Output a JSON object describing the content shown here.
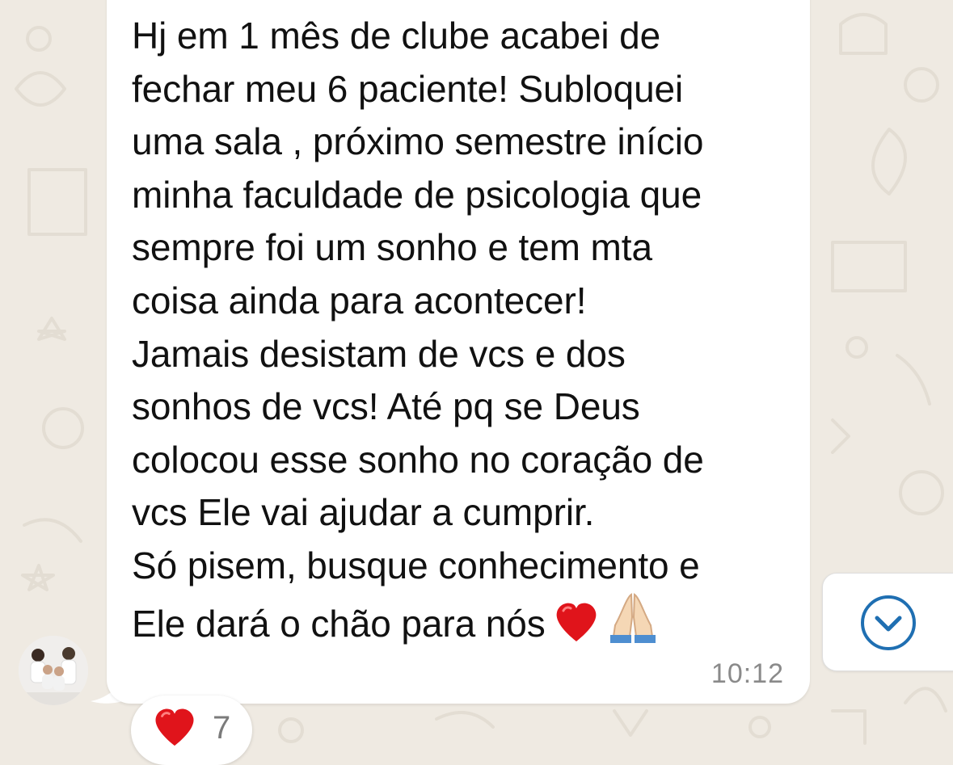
{
  "message": {
    "text": "Hj em 1 mês de clube acabei de\nfechar meu 6 paciente! Subloquei\numa sala ,  próximo semestre início\nminha faculdade de psicologia que\nsempre foi um sonho e tem mta\ncoisa ainda para acontecer!\nJamais desistam de vcs e dos\nsonhos de vcs! Até pq se Deus\ncolocou esse sonho no coração de\nvcs Ele vai ajudar a cumprir.\nSó pisem, busque conhecimento e\nEle dará o chão para nós",
    "timestamp": "10:12",
    "emojis": [
      "red-heart-emoji",
      "folded-hands-emoji"
    ]
  },
  "reaction": {
    "emoji": "red-heart-emoji",
    "count": "7"
  },
  "scroll_button": {
    "icon": "chevron-down-circle-icon"
  },
  "colors": {
    "background": "#efeae2",
    "bubble": "#ffffff",
    "text": "#111111",
    "timestamp": "#8a8a8a",
    "accent": "#1f6fb2"
  }
}
